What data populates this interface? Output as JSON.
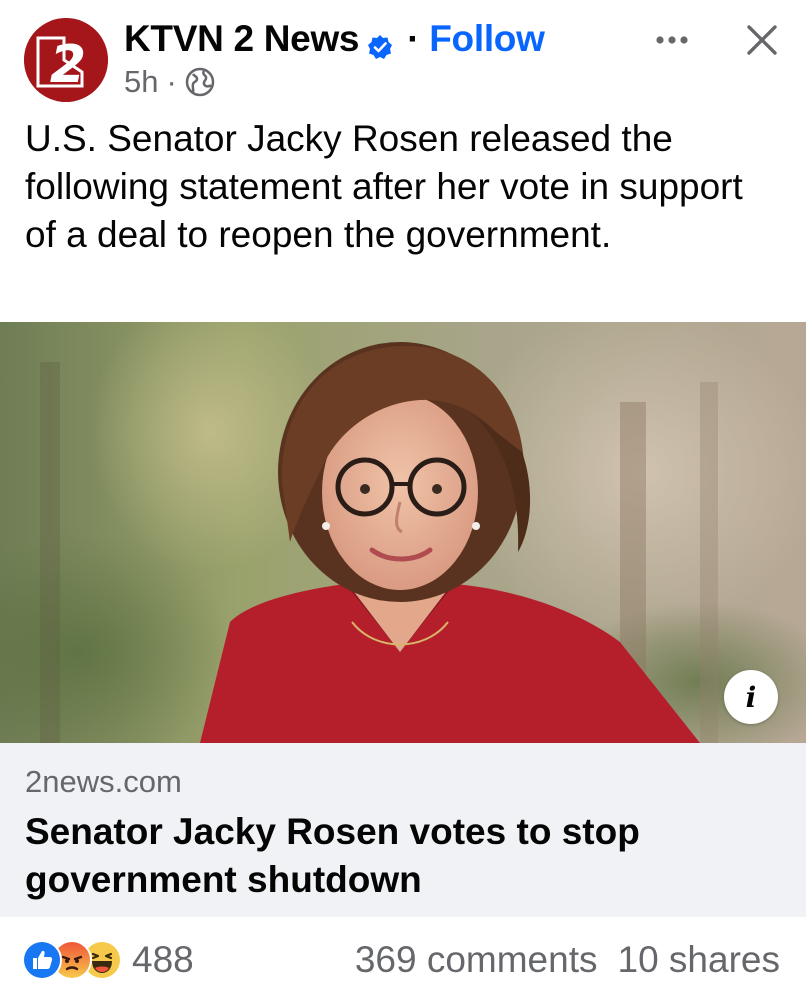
{
  "post": {
    "page_name": "KTVN 2 News",
    "follow_label": "Follow",
    "separator": "·",
    "time": "5h",
    "meta_separator": "·",
    "avatar_text": "2",
    "text": "U.S. Senator Jacky Rosen released the following statement after her vote in support of a deal to reopen the government."
  },
  "icons": {
    "verified": "verified-badge-icon",
    "audience": "globe-icon",
    "more": "more-options-icon",
    "close": "close-icon",
    "info": "info-icon"
  },
  "link_card": {
    "info_label": "i",
    "domain": "2news.com",
    "headline": "Senator Jacky Rosen votes to stop government shutdown"
  },
  "footer": {
    "reaction_count": "488",
    "comments": "369 comments",
    "shares": "10 shares",
    "reactions": [
      "like",
      "angry",
      "haha"
    ]
  },
  "colors": {
    "accent": "#0866ff",
    "brand_red": "#a4161a",
    "secondary_text": "#65676b",
    "card_bg": "#f0f2f5"
  }
}
